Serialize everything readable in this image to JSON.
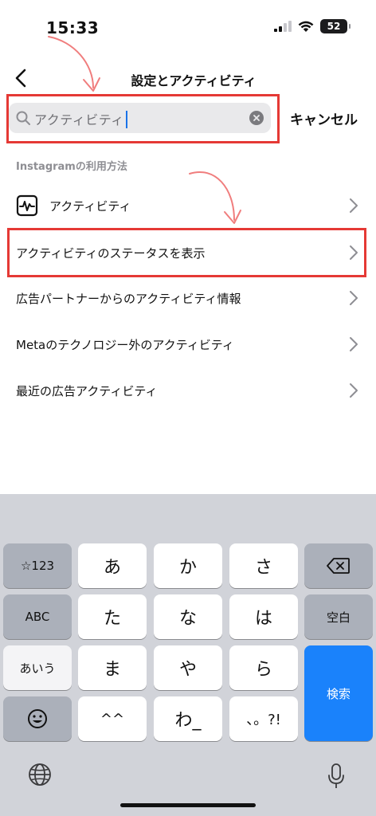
{
  "status": {
    "time": "15:33",
    "battery": "52"
  },
  "nav": {
    "title": "設定とアクティビティ"
  },
  "search": {
    "value": "アクティビティ",
    "cancel_label": "キャンセル"
  },
  "section": {
    "label": "Instagramの利用方法"
  },
  "results": [
    {
      "label": "アクティビティ"
    },
    {
      "label": "アクティビティのステータスを表示"
    },
    {
      "label": "広告パートナーからのアクティビティ情報"
    },
    {
      "label": "Metaのテクノロジー外のアクティビティ"
    },
    {
      "label": "最近の広告アクティビティ"
    }
  ],
  "keyboard": {
    "mode_123": "☆123",
    "mode_abc": "ABC",
    "mode_kana": "あいう",
    "space": "空白",
    "search": "検索",
    "keys": [
      "あ",
      "か",
      "さ",
      "た",
      "な",
      "は",
      "ま",
      "や",
      "ら",
      "^^",
      "わ_",
      "、。?!"
    ]
  },
  "colors": {
    "highlight": "#e53935",
    "accent": "#1a82fb"
  }
}
